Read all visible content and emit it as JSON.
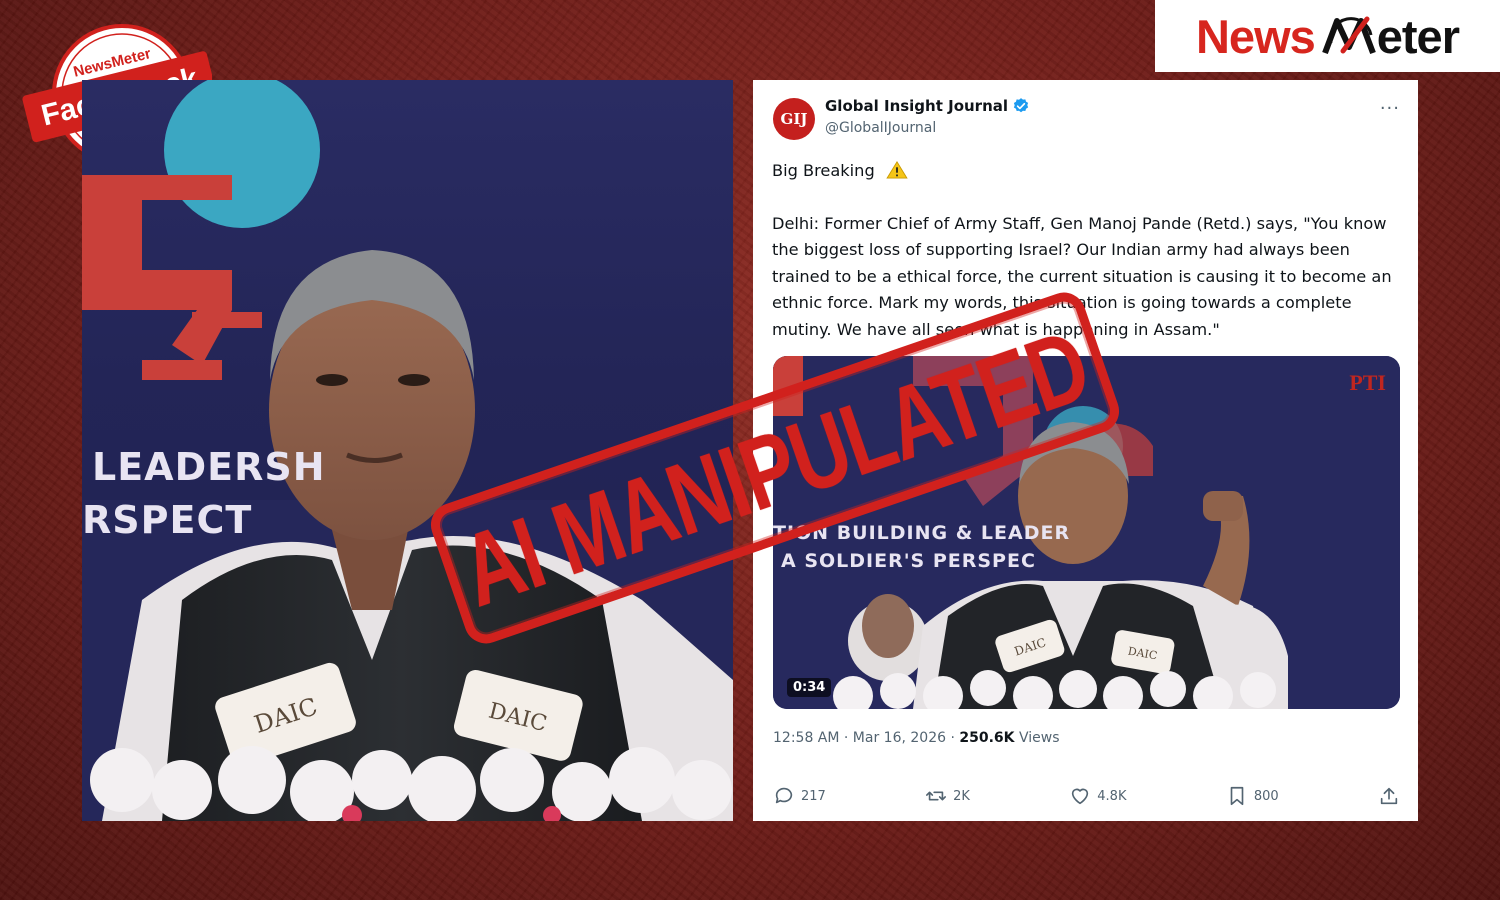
{
  "badge": {
    "brand": "NewsMeter",
    "label": "Fact Check"
  },
  "logo": {
    "news": "News",
    "meter": "eter"
  },
  "left_photo": {
    "overlay_lines": [
      "LEADERSH",
      "RSPECT"
    ],
    "mic_brand": "DAIC"
  },
  "tweet": {
    "avatar_text": "GIJ",
    "account_name": "Global Insight Journal",
    "handle": "@GlobalIJournal",
    "more_label": "···",
    "headline": "Big Breaking",
    "body": "Delhi: Former Chief of Army Staff, Gen Manoj Pande (Retd.) says, \"You know the biggest loss of supporting Israel? Our Indian army had always been trained to be a ethical force, the current situation is causing it to become an ethnic force. Mark my words, this situation is going towards a complete mutiny. We have all seen what is happening in Assam.\"",
    "video": {
      "duration": "0:34",
      "watermark": "PTI",
      "overlay_lines": [
        "TION BUILDING & LEADER",
        "A SOLDIER'S PERSPEC"
      ],
      "mic_brand": "DAIC"
    },
    "timestamp": "12:58 AM · Mar 16, 2026 · ",
    "views_count": "250.6K",
    "views_label": " Views",
    "replies": "217",
    "reposts": "2K",
    "likes": "4.8K",
    "bookmarks": "800"
  },
  "stamp": {
    "text": "AI MANIPULATED"
  },
  "colors": {
    "brand_red": "#d1211d",
    "background": "#7a1f18",
    "verified_blue": "#1d9bf0"
  }
}
